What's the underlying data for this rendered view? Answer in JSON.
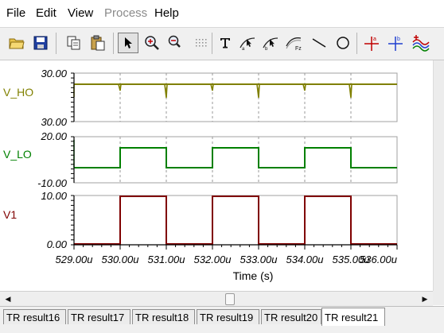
{
  "menu": {
    "items": [
      {
        "label": "File",
        "disabled": false
      },
      {
        "label": "Edit",
        "disabled": false
      },
      {
        "label": "View",
        "disabled": false
      },
      {
        "label": "Process",
        "disabled": true
      },
      {
        "label": "Help",
        "disabled": false
      }
    ]
  },
  "toolbar": {
    "buttons": [
      "open-icon",
      "save-icon",
      "copy-icon",
      "paste-icon",
      "select-arrow-icon",
      "zoom-in-icon",
      "zoom-100-icon",
      "grid-icon",
      "text-tool-icon",
      "cursor-a-icon",
      "cursor-b-icon",
      "cursor-fz-icon",
      "line-tool-icon",
      "circle-tool-icon",
      "cursor-red-a-icon",
      "cursor-blue-b-icon",
      "add-curve-icon"
    ]
  },
  "plot": {
    "x_tick_labels": [
      "529.00u",
      "530.00u",
      "531.00u",
      "532.00u",
      "533.00u",
      "534.00u",
      "535.00u",
      "536.00u"
    ],
    "x_axis_label": "Time (s)",
    "colors": {
      "v_ho": "#808000",
      "v_lo": "#008000",
      "v1": "#800000",
      "grid": "#999999"
    },
    "panels": [
      {
        "name": "V_HO",
        "top_label": "30.00",
        "bottom_label": "30.00"
      },
      {
        "name": "V_LO",
        "top_label": "20.00",
        "bottom_label": "-10.00"
      },
      {
        "name": "V1",
        "top_label": "10.00",
        "bottom_label": "0.00"
      }
    ]
  },
  "tabs": [
    {
      "label": "TR result16",
      "active": false
    },
    {
      "label": "TR result17",
      "active": false
    },
    {
      "label": "TR result18",
      "active": false
    },
    {
      "label": "TR result19",
      "active": false
    },
    {
      "label": "TR result20",
      "active": false
    },
    {
      "label": "TR result21",
      "active": true
    }
  ]
}
